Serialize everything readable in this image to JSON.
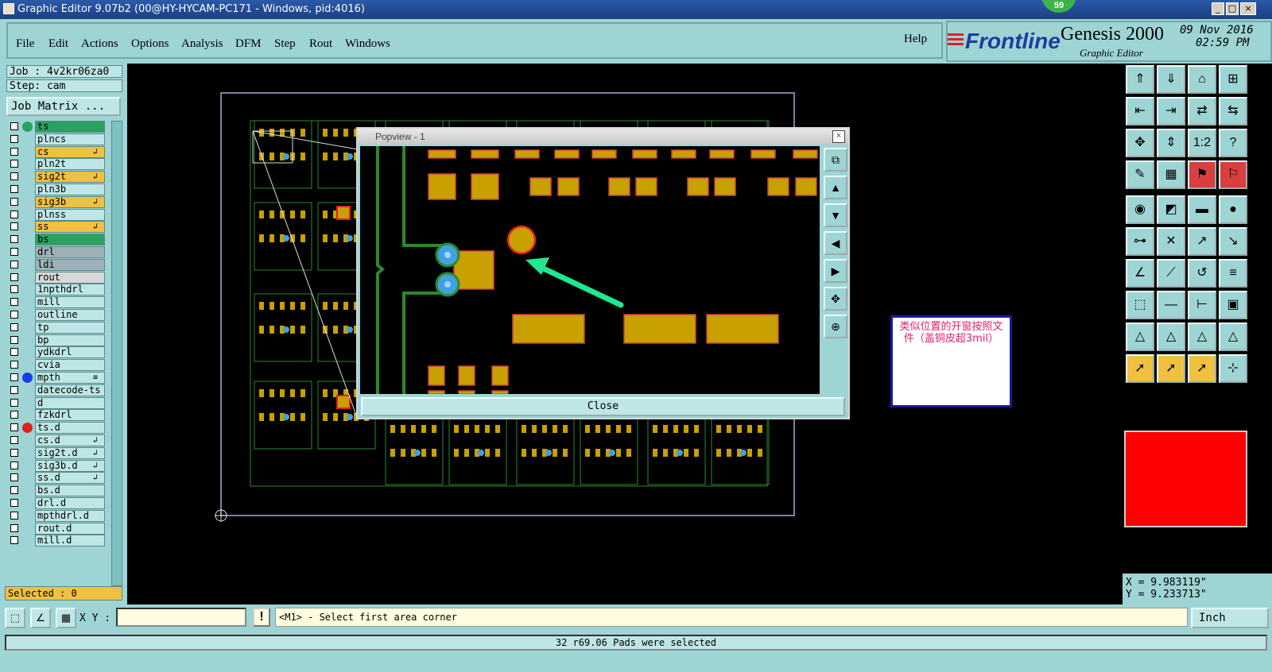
{
  "window": {
    "title": "Graphic Editor 9.07b2 (00@HY-HYCAM-PC171 - Windows, pid:4016)",
    "badge": "59"
  },
  "menu": [
    "File",
    "Edit",
    "Actions",
    "Options",
    "Analysis",
    "DFM",
    "Step",
    "Rout",
    "Windows"
  ],
  "help": "Help",
  "brand": {
    "logo": "Frontline",
    "product": "Genesis 2000",
    "subtitle": "Graphic Editor",
    "date": "09 Nov 2016",
    "time": "02:59 PM"
  },
  "job": {
    "job_line": "Job : 4v2kr06za0",
    "step_line": "Step: cam",
    "matrix_button": "Job Matrix ..."
  },
  "layers": [
    {
      "name": "ts",
      "color": "#2aa15f",
      "dot": "#2aa15f",
      "mark": ""
    },
    {
      "name": "plncs",
      "color": "#bfe6e6",
      "dot": "",
      "mark": ""
    },
    {
      "name": "cs",
      "color": "#f0c040",
      "dot": "",
      "mark": "↲"
    },
    {
      "name": "pln2t",
      "color": "#bfe6e6",
      "dot": "",
      "mark": ""
    },
    {
      "name": "sig2t",
      "color": "#f0c040",
      "dot": "",
      "mark": "↲"
    },
    {
      "name": "pln3b",
      "color": "#bfe6e6",
      "dot": "",
      "mark": ""
    },
    {
      "name": "sig3b",
      "color": "#f0c040",
      "dot": "",
      "mark": "↲"
    },
    {
      "name": "plnss",
      "color": "#bfe6e6",
      "dot": "",
      "mark": ""
    },
    {
      "name": "ss",
      "color": "#f0c040",
      "dot": "",
      "mark": "↲"
    },
    {
      "name": "bs",
      "color": "#2aa15f",
      "dot": "",
      "mark": ""
    },
    {
      "name": "drl",
      "color": "#9fb0b8",
      "dot": "",
      "mark": ""
    },
    {
      "name": "ldi",
      "color": "#9fb0b8",
      "dot": "",
      "mark": ""
    },
    {
      "name": "rout",
      "color": "#d8d8d8",
      "dot": "",
      "mark": ""
    },
    {
      "name": "1npthdrl",
      "color": "#bfe6e6",
      "dot": "",
      "mark": ""
    },
    {
      "name": "mill",
      "color": "#bfe6e6",
      "dot": "",
      "mark": ""
    },
    {
      "name": "outline",
      "color": "#bfe6e6",
      "dot": "",
      "mark": ""
    },
    {
      "name": "tp",
      "color": "#bfe6e6",
      "dot": "",
      "mark": ""
    },
    {
      "name": "bp",
      "color": "#bfe6e6",
      "dot": "",
      "mark": ""
    },
    {
      "name": "ydkdrl",
      "color": "#bfe6e6",
      "dot": "",
      "mark": ""
    },
    {
      "name": "cvia",
      "color": "#bfe6e6",
      "dot": "",
      "mark": ""
    },
    {
      "name": "mpth",
      "color": "#bfe6e6",
      "dot": "#1a3ce0",
      "mark": "≡"
    },
    {
      "name": "datecode-ts",
      "color": "#bfe6e6",
      "dot": "",
      "mark": ""
    },
    {
      "name": "d",
      "color": "#bfe6e6",
      "dot": "",
      "mark": ""
    },
    {
      "name": "fzkdrl",
      "color": "#bfe6e6",
      "dot": "",
      "mark": ""
    },
    {
      "name": "ts.d",
      "color": "#bfe6e6",
      "dot": "#e02020",
      "mark": ""
    },
    {
      "name": "cs.d",
      "color": "#bfe6e6",
      "dot": "",
      "mark": "↲"
    },
    {
      "name": "sig2t.d",
      "color": "#bfe6e6",
      "dot": "",
      "mark": "↲"
    },
    {
      "name": "sig3b.d",
      "color": "#bfe6e6",
      "dot": "",
      "mark": "↲"
    },
    {
      "name": "ss.d",
      "color": "#bfe6e6",
      "dot": "",
      "mark": "↲"
    },
    {
      "name": "bs.d",
      "color": "#bfe6e6",
      "dot": "",
      "mark": ""
    },
    {
      "name": "drl.d",
      "color": "#bfe6e6",
      "dot": "",
      "mark": ""
    },
    {
      "name": "mpthdrl.d",
      "color": "#bfe6e6",
      "dot": "",
      "mark": ""
    },
    {
      "name": "rout.d",
      "color": "#bfe6e6",
      "dot": "",
      "mark": ""
    },
    {
      "name": "mill.d",
      "color": "#bfe6e6",
      "dot": "",
      "mark": ""
    }
  ],
  "selected": "Selected : 0",
  "popview": {
    "title": "Popview - 1",
    "close_label": "Close"
  },
  "note": "类似位置的开窗按照文件（盖铜皮超3mil）",
  "coords": {
    "x": "X = 9.983119\"",
    "y": "Y = 9.233713\""
  },
  "cmd": {
    "xy_label": "X Y :",
    "xy_value": "",
    "prompt": "<M1> - Select first area corner",
    "units": "Inch"
  },
  "status": "32 r69.06 Pads were selected"
}
